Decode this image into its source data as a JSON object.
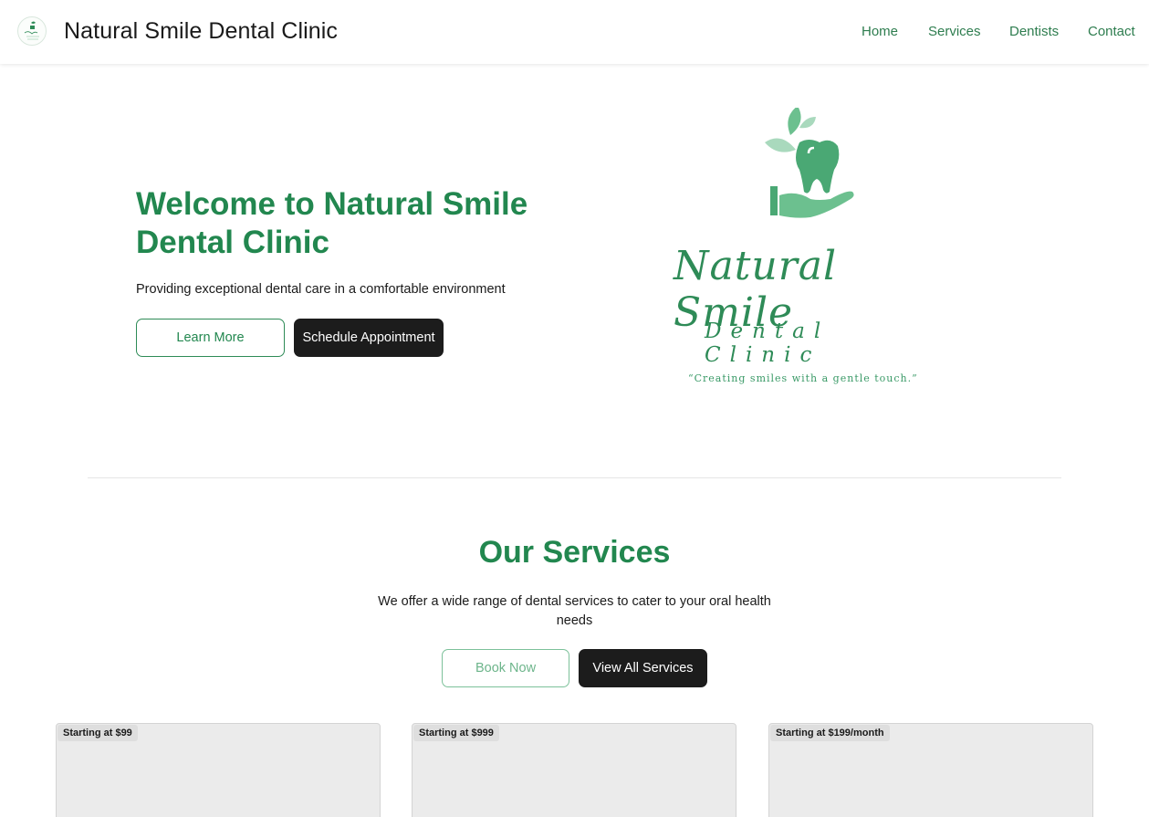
{
  "header": {
    "title": "Natural Smile Dental Clinic",
    "nav": {
      "home": "Home",
      "services": "Services",
      "dentists": "Dentists",
      "contact": "Contact"
    }
  },
  "hero": {
    "title": "Welcome to Natural Smile Dental Clinic",
    "subtitle": "Providing exceptional dental care in a comfortable environment",
    "learn_more": "Learn More",
    "schedule": "Schedule Appointment",
    "logo": {
      "natural": "Natural Smile",
      "dental": "Dental Clinic",
      "tagline": "“Creating smiles with a gentle touch.”"
    }
  },
  "services": {
    "title": "Our Services",
    "subtitle": "We offer a wide range of dental services to cater to your oral health needs",
    "book_now": "Book Now",
    "view_all": "View All Services",
    "cards": [
      {
        "price": "Starting at $99"
      },
      {
        "price": "Starting at $999"
      },
      {
        "price": "Starting at $199/month"
      }
    ]
  },
  "colors": {
    "brand_green": "#22874f",
    "dark_button": "#1c1c1c",
    "card_bg": "#ebebeb"
  }
}
